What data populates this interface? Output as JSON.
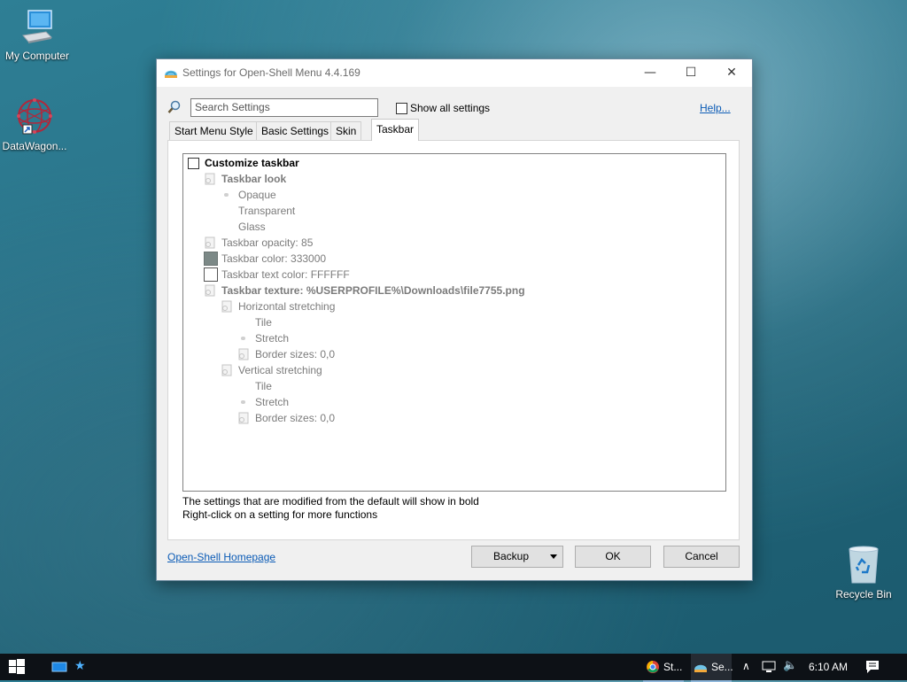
{
  "desktop": {
    "icons": [
      {
        "label": "My Computer"
      },
      {
        "label": "DataWagon..."
      },
      {
        "label": "Recycle Bin"
      }
    ]
  },
  "window": {
    "title": "Settings for Open-Shell Menu 4.4.169",
    "controls": {
      "minimize": "—",
      "maximize": "☐",
      "close": "✕"
    }
  },
  "toolbar": {
    "search_placeholder": "Search Settings",
    "show_all_label": "Show all settings",
    "help_label": "Help..."
  },
  "tabs": [
    {
      "label": "Start Menu Style"
    },
    {
      "label": "Basic Settings"
    },
    {
      "label": "Skin"
    },
    {
      "label": "Taskbar"
    }
  ],
  "settings_tree": {
    "rows": [
      {
        "label": "Customize taskbar"
      },
      {
        "label": "Taskbar look"
      },
      {
        "label": "Opaque"
      },
      {
        "label": "Transparent"
      },
      {
        "label": "Glass"
      },
      {
        "label": "Taskbar opacity: 85"
      },
      {
        "label": "Taskbar color: 333000"
      },
      {
        "label": "Taskbar text color: FFFFFF"
      },
      {
        "label": "Taskbar texture: %USERPROFILE%\\Downloads\\file7755.png"
      },
      {
        "label": "Horizontal stretching"
      },
      {
        "label": "Tile"
      },
      {
        "label": "Stretch"
      },
      {
        "label": "Border sizes: 0,0"
      },
      {
        "label": "Vertical stretching"
      },
      {
        "label": "Tile"
      },
      {
        "label": "Stretch"
      },
      {
        "label": "Border sizes: 0,0"
      }
    ]
  },
  "status": {
    "line1": "The settings that are modified from the default will show in bold",
    "line2": "Right-click on a setting for more functions"
  },
  "footer": {
    "homepage_label": "Open-Shell Homepage",
    "backup_label": "Backup",
    "ok_label": "OK",
    "cancel_label": "Cancel"
  },
  "taskbar": {
    "items": [
      {
        "label": "St..."
      },
      {
        "label": "Se..."
      }
    ],
    "clock": "6:10 AM"
  },
  "colors": {
    "swatch_taskbar_color": "#7c8987",
    "swatch_text_color": "#ffffff",
    "link": "#0b5bb6",
    "taskbar_bg": "#0d1116"
  }
}
